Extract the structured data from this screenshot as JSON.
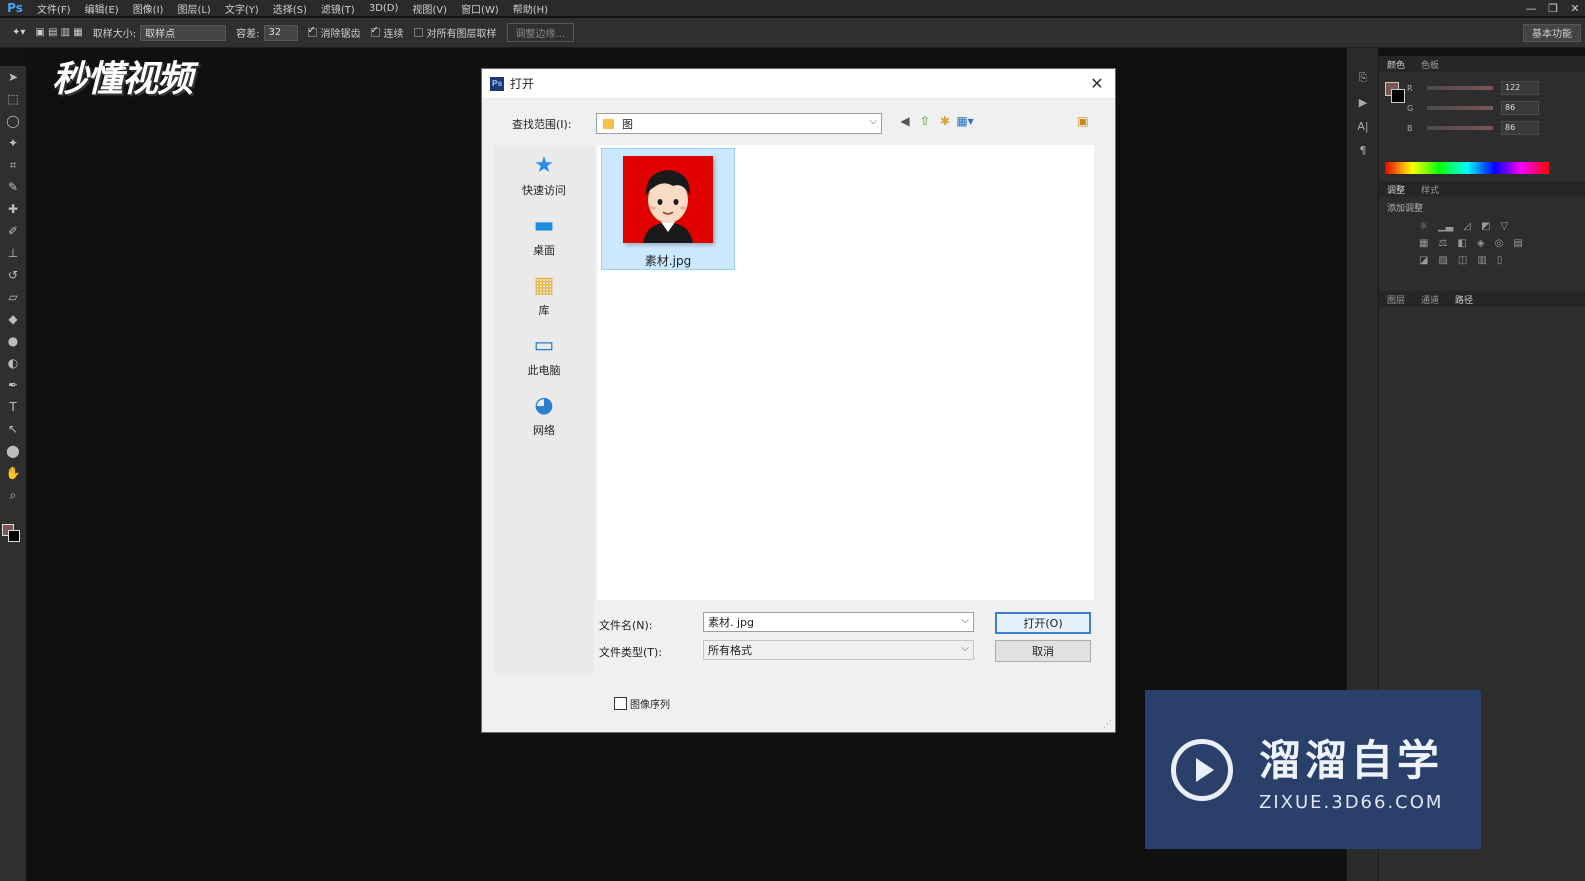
{
  "app": {
    "logo": "Ps",
    "menus": [
      "文件(F)",
      "编辑(E)",
      "图像(I)",
      "图层(L)",
      "文字(Y)",
      "选择(S)",
      "滤镜(T)",
      "3D(D)",
      "视图(V)",
      "窗口(W)",
      "帮助(H)"
    ],
    "window_controls": [
      "—",
      "❐",
      "✕"
    ]
  },
  "options": {
    "sample_size_label": "取样大小:",
    "sample_size_value": "取样点",
    "tolerance_label": "容差:",
    "tolerance_value": "32",
    "antialias_label": "消除锯齿",
    "contiguous_label": "连续",
    "sample_all_label": "对所有图层取样",
    "refine_edge_label": "调整边缘...",
    "workspace_label": "基本功能"
  },
  "watermark_top": {
    "text": "秒懂视频"
  },
  "right_panel": {
    "color_tabs": [
      "颜色",
      "色板"
    ],
    "r_label": "R",
    "r_value": "122",
    "g_label": "G",
    "g_value": "86",
    "b_label": "B",
    "b_value": "86",
    "adj_tabs": [
      "调整",
      "样式"
    ],
    "adj_title": "添加调整",
    "layer_tabs": [
      "图层",
      "通道",
      "路径"
    ]
  },
  "dialog": {
    "title": "打开",
    "lookin_label": "查找范围(I):",
    "lookin_value": "图",
    "places": [
      {
        "label": "快速访问",
        "icon": "★"
      },
      {
        "label": "桌面",
        "icon": "▬"
      },
      {
        "label": "库",
        "icon": "▦"
      },
      {
        "label": "此电脑",
        "icon": "▭"
      },
      {
        "label": "网络",
        "icon": "◕"
      }
    ],
    "file": {
      "name": "素材.jpg"
    },
    "filename_label": "文件名(N):",
    "filename_value": "素材. jpg",
    "filetype_label": "文件类型(T):",
    "filetype_value": "所有格式",
    "open_button": "打开(O)",
    "cancel_button": "取消",
    "image_sequence_label": "图像序列"
  },
  "watermark_bottom": {
    "cn": "溜溜自学",
    "en": "ZIXUE.3D66.COM"
  }
}
